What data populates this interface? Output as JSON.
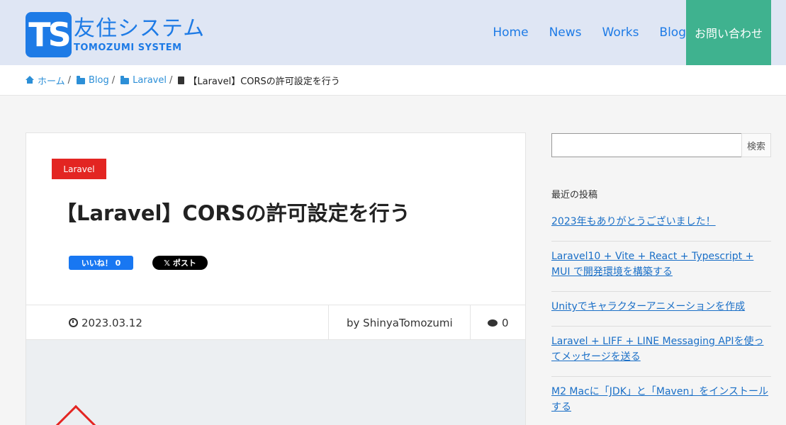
{
  "header": {
    "logo_mark": "TS",
    "logo_jp": "友住システム",
    "logo_en": "TOMOZUMI SYSTEM",
    "nav": [
      "Home",
      "News",
      "Works",
      "Blog"
    ],
    "contact": "お問い合わせ",
    "colors": {
      "brand": "#1e7be6",
      "contact_bg": "#3fb28f",
      "header_bg": "#dfe6f4"
    }
  },
  "breadcrumb": {
    "items": [
      "ホーム",
      "Blog",
      "Laravel"
    ],
    "current": "【Laravel】CORSの許可設定を行う"
  },
  "article": {
    "category": "Laravel",
    "title": "【Laravel】CORSの許可設定を行う",
    "fb_like": "いいね！ 0",
    "x_post": "𝕏 ポスト",
    "date": "2023.03.12",
    "author": "by ShinyaTomozumi",
    "comments": "0"
  },
  "sidebar": {
    "search_button": "検索",
    "search_placeholder": "",
    "recent_heading": "最近の投稿",
    "recent_posts": [
      "2023年もありがとうございました！",
      "Laravel10 + Vite + React + Typescript + MUI で開発環境を構築する",
      "Unityでキャラクターアニメーションを作成",
      "Laravel + LIFF + LINE Messaging APIを使ってメッセージを送る",
      "M2 Macに「JDK」と「Maven」をインストールする"
    ]
  }
}
